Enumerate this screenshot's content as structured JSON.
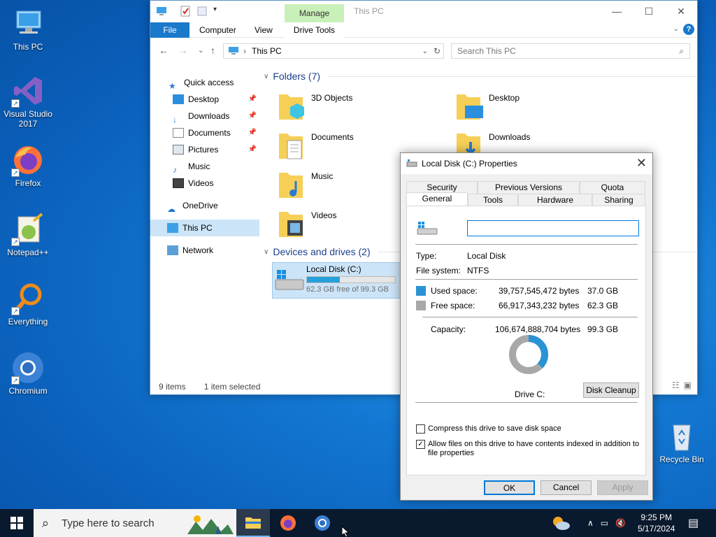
{
  "desktop": {
    "icons": [
      {
        "label": "This PC",
        "icon": "this-pc-icon"
      },
      {
        "label": "Visual Studio 2017",
        "icon": "visual-studio-icon"
      },
      {
        "label": "Firefox",
        "icon": "firefox-icon"
      },
      {
        "label": "Notepad++",
        "icon": "notepadpp-icon"
      },
      {
        "label": "Everything",
        "icon": "everything-icon"
      },
      {
        "label": "Chromium",
        "icon": "chromium-icon"
      },
      {
        "label": "Recycle Bin",
        "icon": "recycle-bin-icon"
      }
    ]
  },
  "explorer": {
    "title": "This PC",
    "manage_tab": "Manage",
    "ribbon_tabs": [
      "File",
      "Computer",
      "View",
      "Drive Tools"
    ],
    "address": "This PC",
    "search_placeholder": "Search This PC",
    "nav": [
      {
        "label": "Quick access",
        "icon": "star-icon",
        "pinned": false
      },
      {
        "label": "Desktop",
        "icon": "desktop-icon",
        "pinned": true
      },
      {
        "label": "Downloads",
        "icon": "download-icon",
        "pinned": true
      },
      {
        "label": "Documents",
        "icon": "documents-icon",
        "pinned": true
      },
      {
        "label": "Pictures",
        "icon": "pictures-icon",
        "pinned": true
      },
      {
        "label": "Music",
        "icon": "music-icon",
        "pinned": false
      },
      {
        "label": "Videos",
        "icon": "videos-icon",
        "pinned": false
      },
      {
        "label": "OneDrive",
        "icon": "cloud-icon",
        "pinned": false
      },
      {
        "label": "This PC",
        "icon": "this-pc-icon",
        "pinned": false
      },
      {
        "label": "Network",
        "icon": "network-icon",
        "pinned": false
      }
    ],
    "folders_header": "Folders (7)",
    "folders": [
      "3D Objects",
      "Desktop",
      "Documents",
      "Downloads",
      "Music",
      "Videos"
    ],
    "devices_header": "Devices and drives (2)",
    "drive": {
      "name": "Local Disk (C:)",
      "free_text": "62.3 GB free of 99.3 GB",
      "used_fraction": 0.373
    },
    "status": {
      "items": "9 items",
      "selected": "1 item selected"
    }
  },
  "dialog": {
    "title": "Local Disk (C:) Properties",
    "tabs_top": [
      "Security",
      "Previous Versions",
      "Quota"
    ],
    "tabs_bottom": [
      "General",
      "Tools",
      "Hardware",
      "Sharing"
    ],
    "name_value": "",
    "type_label": "Type:",
    "type_value": "Local Disk",
    "fs_label": "File system:",
    "fs_value": "NTFS",
    "used_label": "Used space:",
    "used_bytes": "39,757,545,472 bytes",
    "used_gb": "37.0 GB",
    "free_label": "Free space:",
    "free_bytes": "66,917,343,232 bytes",
    "free_gb": "62.3 GB",
    "cap_label": "Capacity:",
    "cap_bytes": "106,674,888,704 bytes",
    "cap_gb": "99.3 GB",
    "drive_label": "Drive C:",
    "cleanup": "Disk Cleanup",
    "compress": "Compress this drive to save disk space",
    "compress_checked": false,
    "index": "Allow files on this drive to have contents indexed in addition to file properties",
    "index_checked": true,
    "ok": "OK",
    "cancel": "Cancel",
    "apply": "Apply",
    "used_color": "#2a93d5",
    "free_color": "#a8a8a8"
  },
  "taskbar": {
    "search_placeholder": "Type here to search",
    "time": "9:25 PM",
    "date": "5/17/2024"
  }
}
